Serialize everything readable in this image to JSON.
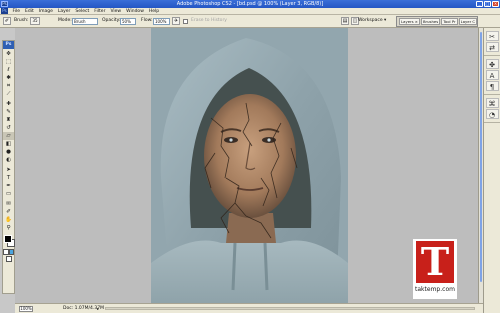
{
  "window": {
    "title": "Adobe Photoshop CS2 - [bd.psd @ 100% (Layer 3, RGB/8)]",
    "buttons": [
      "_",
      "□",
      "×"
    ]
  },
  "menu": {
    "items": [
      "File",
      "Edit",
      "Image",
      "Layer",
      "Select",
      "Filter",
      "View",
      "Window",
      "Help"
    ]
  },
  "options": {
    "brush_label": "Brush:",
    "brush_size": "35",
    "mode_label": "Mode:",
    "mode_value": "Brush",
    "opacity_label": "Opacity:",
    "opacity_value": "50%",
    "flow_label": "Flow:",
    "flow_value": "100%",
    "erase_history_label": "Erase to History",
    "workspace_label": "Workspace ▾",
    "palette_tabs": [
      "Layers ×",
      "Brushes",
      "Tool Pr",
      "Layer C"
    ]
  },
  "tools": {
    "badge": "Ps",
    "items": [
      {
        "name": "move-tool",
        "glyph": "✥"
      },
      {
        "name": "marquee-tool",
        "glyph": "⬚"
      },
      {
        "name": "lasso-tool",
        "glyph": "ℓ"
      },
      {
        "name": "magic-wand-tool",
        "glyph": "✱"
      },
      {
        "name": "crop-tool",
        "glyph": "⌗"
      },
      {
        "name": "slice-tool",
        "glyph": "⟋"
      },
      {
        "name": "healing-brush-tool",
        "glyph": "✚"
      },
      {
        "name": "brush-tool",
        "glyph": "✎"
      },
      {
        "name": "clone-stamp-tool",
        "glyph": "♜"
      },
      {
        "name": "history-brush-tool",
        "glyph": "↺"
      },
      {
        "name": "eraser-tool",
        "glyph": "▱"
      },
      {
        "name": "gradient-tool",
        "glyph": "◧"
      },
      {
        "name": "blur-tool",
        "glyph": "●"
      },
      {
        "name": "dodge-tool",
        "glyph": "◐"
      },
      {
        "name": "path-selection-tool",
        "glyph": "➤"
      },
      {
        "name": "type-tool",
        "glyph": "T"
      },
      {
        "name": "pen-tool",
        "glyph": "✒"
      },
      {
        "name": "shape-tool",
        "glyph": "▭"
      },
      {
        "name": "notes-tool",
        "glyph": "✉"
      },
      {
        "name": "eyedropper-tool",
        "glyph": "✐"
      },
      {
        "name": "hand-tool",
        "glyph": "✋"
      },
      {
        "name": "zoom-tool",
        "glyph": "⚲"
      }
    ]
  },
  "dock": {
    "icons": [
      "✂",
      "⇄",
      "✤",
      "A",
      "¶",
      "⌘",
      "◔"
    ]
  },
  "status": {
    "zoom": "100%",
    "doc": "Doc: 1.07M/4.37M",
    "arrow": "▸"
  },
  "watermark": {
    "letter": "T",
    "site": "taktemp.com"
  },
  "colors": {
    "titlebar": "#2456c4",
    "chrome": "#ece9d8",
    "workarea": "#bdbdbd",
    "watermark_red": "#c8201a",
    "quickmask_blue": "#4ba5df"
  }
}
